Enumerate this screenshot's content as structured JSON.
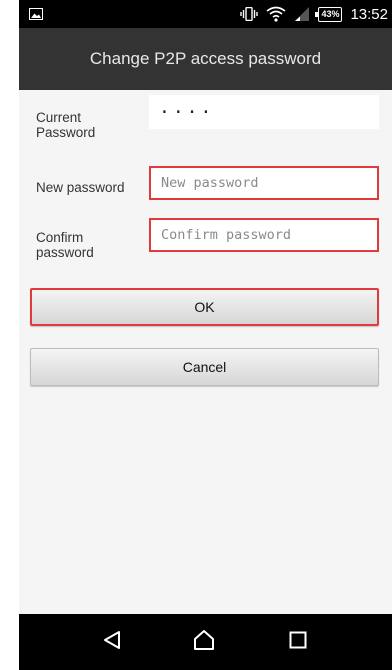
{
  "status_bar": {
    "battery": "43%",
    "time": "13:52",
    "icons": [
      "image-notification-icon",
      "vibrate-icon",
      "wifi-icon",
      "signal-icon",
      "battery-icon"
    ]
  },
  "title_bar": {
    "title": "Change P2P access password"
  },
  "form": {
    "current_password": {
      "label": "Current Password",
      "value": "····"
    },
    "new_password": {
      "label": "New password",
      "placeholder": "New password",
      "value": ""
    },
    "confirm_password": {
      "label": "Confirm password",
      "placeholder": "Confirm password",
      "value": ""
    }
  },
  "buttons": {
    "ok": "OK",
    "cancel": "Cancel"
  },
  "nav_bar": {
    "icons": [
      "back-icon",
      "home-icon",
      "recents-icon"
    ]
  },
  "colors": {
    "highlight": "#e2393c",
    "title_bar": "#333333",
    "background": "#f5f5f5"
  }
}
